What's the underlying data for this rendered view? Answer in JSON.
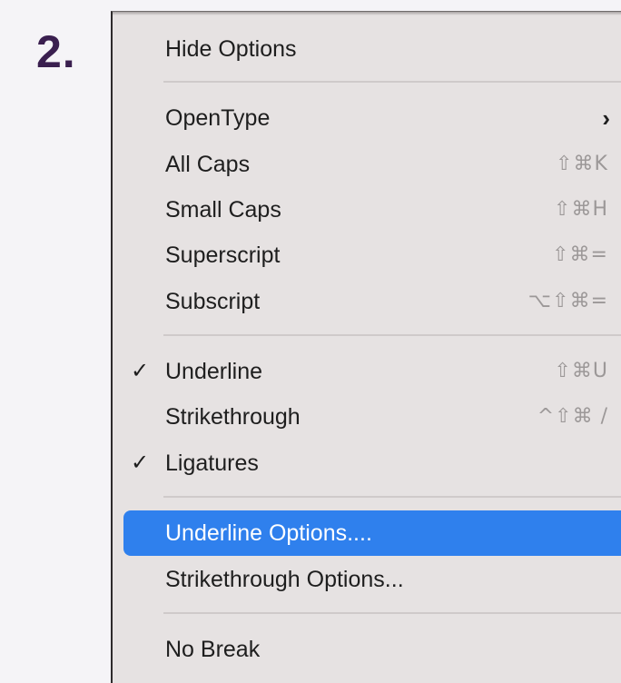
{
  "step": {
    "label": "2."
  },
  "menu": {
    "items": [
      {
        "label": "Hide Options",
        "checked": false,
        "shortcut": ""
      },
      {
        "label": "OpenType",
        "checked": false,
        "shortcut": "",
        "submenu": true
      },
      {
        "label": "All Caps",
        "checked": false,
        "shortcut": "⇧⌘K"
      },
      {
        "label": "Small Caps",
        "checked": false,
        "shortcut": "⇧⌘H"
      },
      {
        "label": "Superscript",
        "checked": false,
        "shortcut": "⇧⌘="
      },
      {
        "label": "Subscript",
        "checked": false,
        "shortcut": "⌥⇧⌘="
      },
      {
        "label": "Underline",
        "checked": true,
        "shortcut": "⇧⌘U"
      },
      {
        "label": "Strikethrough",
        "checked": false,
        "shortcut": "^⇧⌘ /"
      },
      {
        "label": "Ligatures",
        "checked": true,
        "shortcut": ""
      },
      {
        "label": "Underline Options....",
        "checked": false,
        "shortcut": "",
        "highlighted": true
      },
      {
        "label": "Strikethrough Options...",
        "checked": false,
        "shortcut": ""
      },
      {
        "label": "No Break",
        "checked": false,
        "shortcut": ""
      }
    ],
    "check_glyph": "✓",
    "submenu_glyph": "›",
    "highlight_color": "#2f80ed"
  }
}
